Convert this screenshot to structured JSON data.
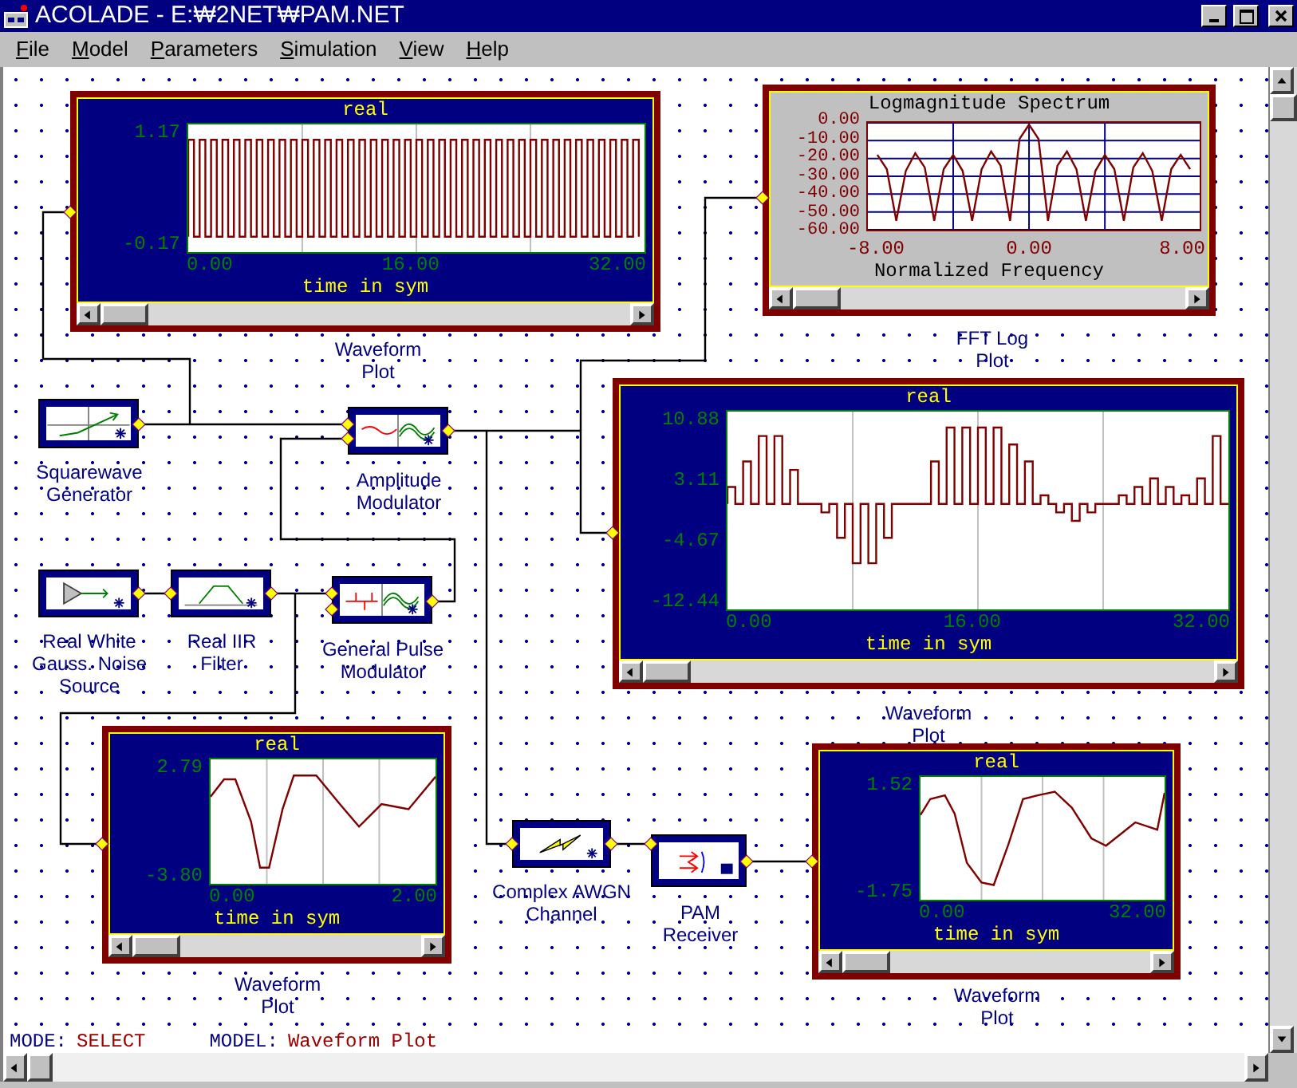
{
  "window": {
    "title": "ACOLADE - E:₩2NET₩PAM.NET"
  },
  "menu": [
    "File",
    "Model",
    "Parameters",
    "Simulation",
    "View",
    "Help"
  ],
  "plots": [
    {
      "kind": "waveform",
      "title": "real",
      "y_ticks": [
        "1.17",
        "-0.17"
      ],
      "x_ticks": [
        "0.00",
        "16.00",
        "32.00"
      ],
      "x_label": "time in sym",
      "caption": "Waveform Plot"
    },
    {
      "kind": "spectrum",
      "caption": "FFT Log Plot",
      "chart_data": {
        "type": "line",
        "title": "Logmagnitude Spectrum",
        "xlabel": "Normalized Frequency",
        "xlim": [
          -8.5,
          9
        ],
        "ylim": [
          -60,
          0
        ],
        "grid": true,
        "xticks": [
          {
            "value": -8,
            "label": "-8.00"
          },
          {
            "value": 0,
            "label": "0.00"
          },
          {
            "value": 8,
            "label": "8.00"
          }
        ],
        "yticks": [
          {
            "value": 0,
            "label": "0.00"
          },
          {
            "value": -10,
            "label": "-10.00"
          },
          {
            "value": -20,
            "label": "-20.00"
          },
          {
            "value": -30,
            "label": "-30.00"
          },
          {
            "value": -40,
            "label": "-40.00"
          },
          {
            "value": -50,
            "label": "-50.00"
          },
          {
            "value": -60,
            "label": "-60.00"
          }
        ],
        "x": [
          -8,
          -7.5,
          -7,
          -6.5,
          -6,
          -5.5,
          -5,
          -4.5,
          -4,
          -3.5,
          -3,
          -2.5,
          -2,
          -1.5,
          -1,
          -0.5,
          0,
          0.5,
          1,
          1.5,
          2,
          2.5,
          3,
          3.5,
          4,
          4.5,
          5,
          5.5,
          6,
          6.5,
          7,
          7.5,
          8,
          8.5
        ],
        "series": [
          {
            "color": "#800000",
            "values": [
              -18,
              -26,
              -55,
              -27,
              -17,
              -25,
              -55,
              -26,
              -18,
              -27,
              -55,
              -26,
              -16,
              -24,
              -55,
              -9,
              -1,
              -9,
              -55,
              -24,
              -16,
              -26,
              -55,
              -27,
              -18,
              -26,
              -55,
              -25,
              -17,
              -27,
              -55,
              -26,
              -18,
              -26
            ]
          }
        ]
      }
    },
    {
      "kind": "waveform",
      "title": "real",
      "y_ticks": [
        "10.88",
        "3.11",
        "-4.67",
        "-12.44"
      ],
      "x_ticks": [
        "0.00",
        "16.00",
        "32.00"
      ],
      "x_label": "time in sym",
      "caption": "Waveform Plot"
    },
    {
      "kind": "waveform",
      "title": "real",
      "y_ticks": [
        "2.79",
        "-3.80"
      ],
      "x_ticks": [
        "0.00",
        "2.00"
      ],
      "x_label": "time in sym",
      "caption": "Waveform Plot"
    },
    {
      "kind": "waveform",
      "title": "real",
      "y_ticks": [
        "1.52",
        "-1.75"
      ],
      "x_ticks": [
        "0.00",
        "32.00"
      ],
      "x_label": "time in sym",
      "caption": "Waveform Plot"
    }
  ],
  "blocks": [
    {
      "kind": "squarewave",
      "label": "Squarewave Generator"
    },
    {
      "kind": "modulator",
      "label": "Amplitude Modulator"
    },
    {
      "kind": "noise",
      "label": "Real White Gauss. Noise Source"
    },
    {
      "kind": "filter",
      "label": "Real IIR Filter"
    },
    {
      "kind": "pulse",
      "label": "General Pulse Modulator"
    },
    {
      "kind": "channel",
      "label": "Complex AWGN Channel"
    },
    {
      "kind": "receiver",
      "label": "PAM Receiver"
    }
  ],
  "status_bar": {
    "mode_label": "MODE:",
    "mode": "SELECT",
    "model_label": "MODEL:",
    "model": "Waveform Plot"
  }
}
